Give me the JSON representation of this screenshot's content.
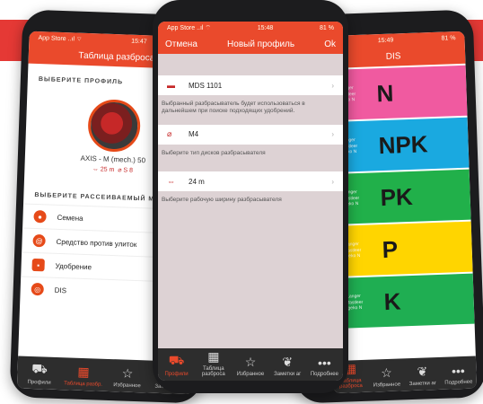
{
  "left_phone": {
    "title": "Таблица разброса",
    "status": {
      "carrier": "App Store ..ıl ⌔",
      "time": "15:47"
    },
    "select_profile_title": "ВЫБЕРИТЕ ПРОФИЛЬ",
    "profile_name": "AXIS - M (mech.) 50",
    "profile_width": "25 m",
    "profile_disc": "S 8",
    "select_material_title": "ВЫБЕРИТЕ РАССЕИВАЕМЫЙ МА",
    "materials": [
      "Семена",
      "Средство против улиток",
      "Удобрение",
      "DIS"
    ],
    "tabs": [
      "Профили",
      "Таблица разбр.",
      "Избранное",
      "Заметки по..."
    ]
  },
  "middle_phone": {
    "status": {
      "carrier": "App Store ..ıl ⌔",
      "time": "15:48",
      "battery": "81 %"
    },
    "cancel": "Отмена",
    "title": "Новый профиль",
    "ok": "Ok",
    "spreader": "MDS 1101",
    "spreader_hint": "Выбранный разбрасыватель будет использоваться в дальнейшем при поиске подходящих удобрений.",
    "disc": "M4",
    "disc_hint": "Выберите тип дисков разбрасывателя",
    "width": "24 m",
    "width_hint": "Выберите рабочую ширину разбрасывателя",
    "tabs": [
      "Профили",
      "Таблица разброса",
      "Избранное",
      "Заметки аг",
      "Подробнее"
    ]
  },
  "right_phone": {
    "status": {
      "time": "15:49",
      "battery": "81 %"
    },
    "title": "DIS",
    "band_caption": "B Langer\nB-Tastleer\nangeko N",
    "categories": [
      {
        "label": "N",
        "color": "#f05aa0"
      },
      {
        "label": "NPK",
        "color": "#1aa9e0"
      },
      {
        "label": "PK",
        "color": "#21b04a"
      },
      {
        "label": "P",
        "color": "#ffd500"
      },
      {
        "label": "K",
        "color": "#1fae52"
      }
    ],
    "tabs": [
      "Таблица разброса",
      "Избранное",
      "Заметки аг",
      "Подробнее"
    ]
  }
}
